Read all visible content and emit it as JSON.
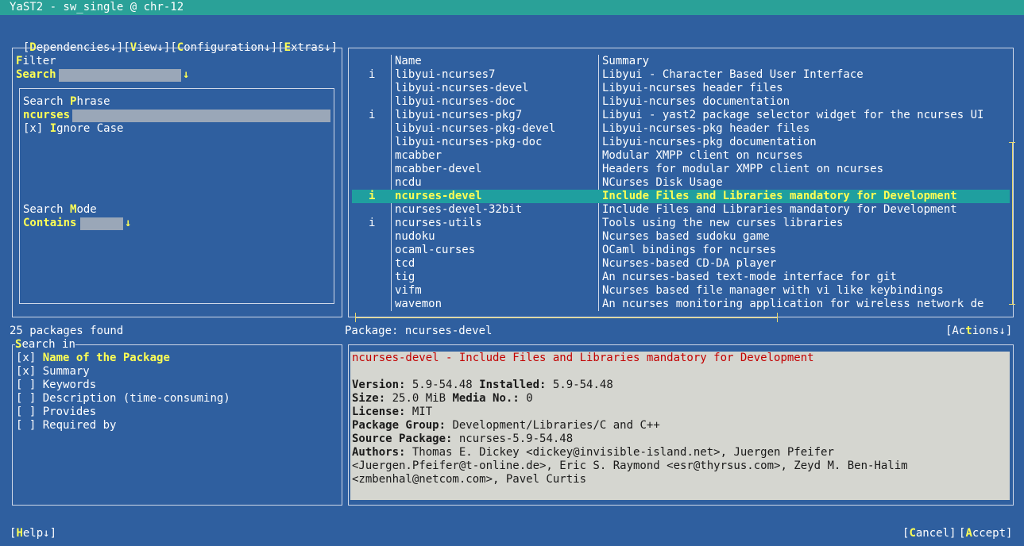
{
  "window": {
    "title": "YaST2 - sw_single @ chr-12"
  },
  "menubar": [
    {
      "pre": "[",
      "hot": "D",
      "rest": "ependencies↓]"
    },
    {
      "pre": "[",
      "hot": "V",
      "rest": "iew↓]"
    },
    {
      "pre": "[",
      "hot": "C",
      "rest": "onfiguration↓]"
    },
    {
      "pre": "[",
      "hot": "E",
      "rest": "xtras↓]"
    }
  ],
  "filter": {
    "label_hot": "F",
    "label_rest": "ilter",
    "value": "Search",
    "arrow": "↓",
    "phrase_label_pre": "Search ",
    "phrase_label_hot": "P",
    "phrase_label_rest": "hrase",
    "phrase_value": "ncurses",
    "ignore_case_box": "[x]",
    "ignore_case_hot": "I",
    "ignore_case_rest": "gnore Case",
    "mode_label_pre": "Search ",
    "mode_label_hot": "M",
    "mode_label_rest": "ode",
    "mode_value": "Contains",
    "mode_arrow": "↓"
  },
  "packages": {
    "header": {
      "name": "Name",
      "summary": "Summary"
    },
    "rows": [
      {
        "status": "i",
        "name": "libyui-ncurses7",
        "summary": "Libyui - Character Based User Interface"
      },
      {
        "status": "",
        "name": "libyui-ncurses-devel",
        "summary": "Libyui-ncurses header files"
      },
      {
        "status": "",
        "name": "libyui-ncurses-doc",
        "summary": "Libyui-ncurses documentation"
      },
      {
        "status": "i",
        "name": "libyui-ncurses-pkg7",
        "summary": "Libyui - yast2 package selector widget for the ncurses UI"
      },
      {
        "status": "",
        "name": "libyui-ncurses-pkg-devel",
        "summary": "Libyui-ncurses-pkg header files"
      },
      {
        "status": "",
        "name": "libyui-ncurses-pkg-doc",
        "summary": "Libyui-ncurses-pkg documentation"
      },
      {
        "status": "",
        "name": "mcabber",
        "summary": "Modular XMPP client on ncurses"
      },
      {
        "status": "",
        "name": "mcabber-devel",
        "summary": "Headers for modular XMPP client on ncurses"
      },
      {
        "status": "",
        "name": "ncdu",
        "summary": "NCurses Disk Usage"
      },
      {
        "status": "i",
        "name": "ncurses-devel",
        "summary": "Include Files and Libraries mandatory for Development",
        "selected": true
      },
      {
        "status": "",
        "name": "ncurses-devel-32bit",
        "summary": "Include Files and Libraries mandatory for Development"
      },
      {
        "status": "i",
        "name": "ncurses-utils",
        "summary": "Tools using the new curses libraries"
      },
      {
        "status": "",
        "name": "nudoku",
        "summary": "Ncurses based sudoku game"
      },
      {
        "status": "",
        "name": "ocaml-curses",
        "summary": "OCaml bindings for ncurses"
      },
      {
        "status": "",
        "name": "tcd",
        "summary": "Ncurses-based CD-DA player"
      },
      {
        "status": "",
        "name": "tig",
        "summary": "An ncurses-based text-mode interface for git"
      },
      {
        "status": "",
        "name": "vifm",
        "summary": "Ncurses based file manager with vi like keybindings"
      },
      {
        "status": "",
        "name": "wavemon",
        "summary": "An ncurses monitoring application for wireless network de"
      }
    ]
  },
  "status": {
    "found": "25 packages found",
    "package_label": "Package: ncurses-devel"
  },
  "actions": {
    "pre": "[Ac",
    "hot": "t",
    "rest": "ions↓]"
  },
  "search_in": {
    "title_hot": "S",
    "title_rest": "earch in",
    "items": [
      {
        "box": "[x]",
        "label": "Name of the Package",
        "bold": true
      },
      {
        "box": "[x]",
        "label": "Summary"
      },
      {
        "box": "[ ]",
        "label": "Keywords"
      },
      {
        "box": "[ ]",
        "label": "Description (time-consuming)"
      },
      {
        "box": "[ ]",
        "label": "Provides"
      },
      {
        "box": "[ ]",
        "label": "Required by"
      }
    ]
  },
  "details": {
    "headline": "ncurses-devel - Include Files and Libraries mandatory for Development",
    "version_label": "Version:",
    "version": "5.9-54.48",
    "installed_label": "Installed:",
    "installed": "5.9-54.48",
    "size_label": "Size:",
    "size": "25.0 MiB",
    "media_label": "Media No.:",
    "media": "0",
    "license_label": "License:",
    "license": "MIT",
    "group_label": "Package Group:",
    "group": "Development/Libraries/C and C++",
    "source_label": "Source Package:",
    "source": "ncurses-5.9-54.48",
    "authors_label": "Authors:",
    "authors_1": "Thomas E. Dickey <dickey@invisible-island.net>, Juergen Pfeifer",
    "authors_2": "<Juergen.Pfeifer@t-online.de>, Eric S. Raymond <esr@thyrsus.com>, Zeyd M. Ben-Halim",
    "authors_3": "<zmbenhal@netcom.com>, Pavel Curtis"
  },
  "footer": {
    "help": {
      "pre": "[",
      "hot": "H",
      "rest": "elp↓]"
    },
    "cancel": {
      "pre": "[",
      "hot": "C",
      "rest": "ancel]"
    },
    "accept": {
      "pre": "[",
      "hot": "A",
      "rest": "ccept]"
    }
  },
  "colors": {
    "background": "#2f5f9f",
    "titlebar": "#2aa198",
    "hotkey": "#ffff54",
    "selection": "#1f9f9f",
    "info_bg": "#d5d6d0",
    "headline": "#c20000"
  }
}
